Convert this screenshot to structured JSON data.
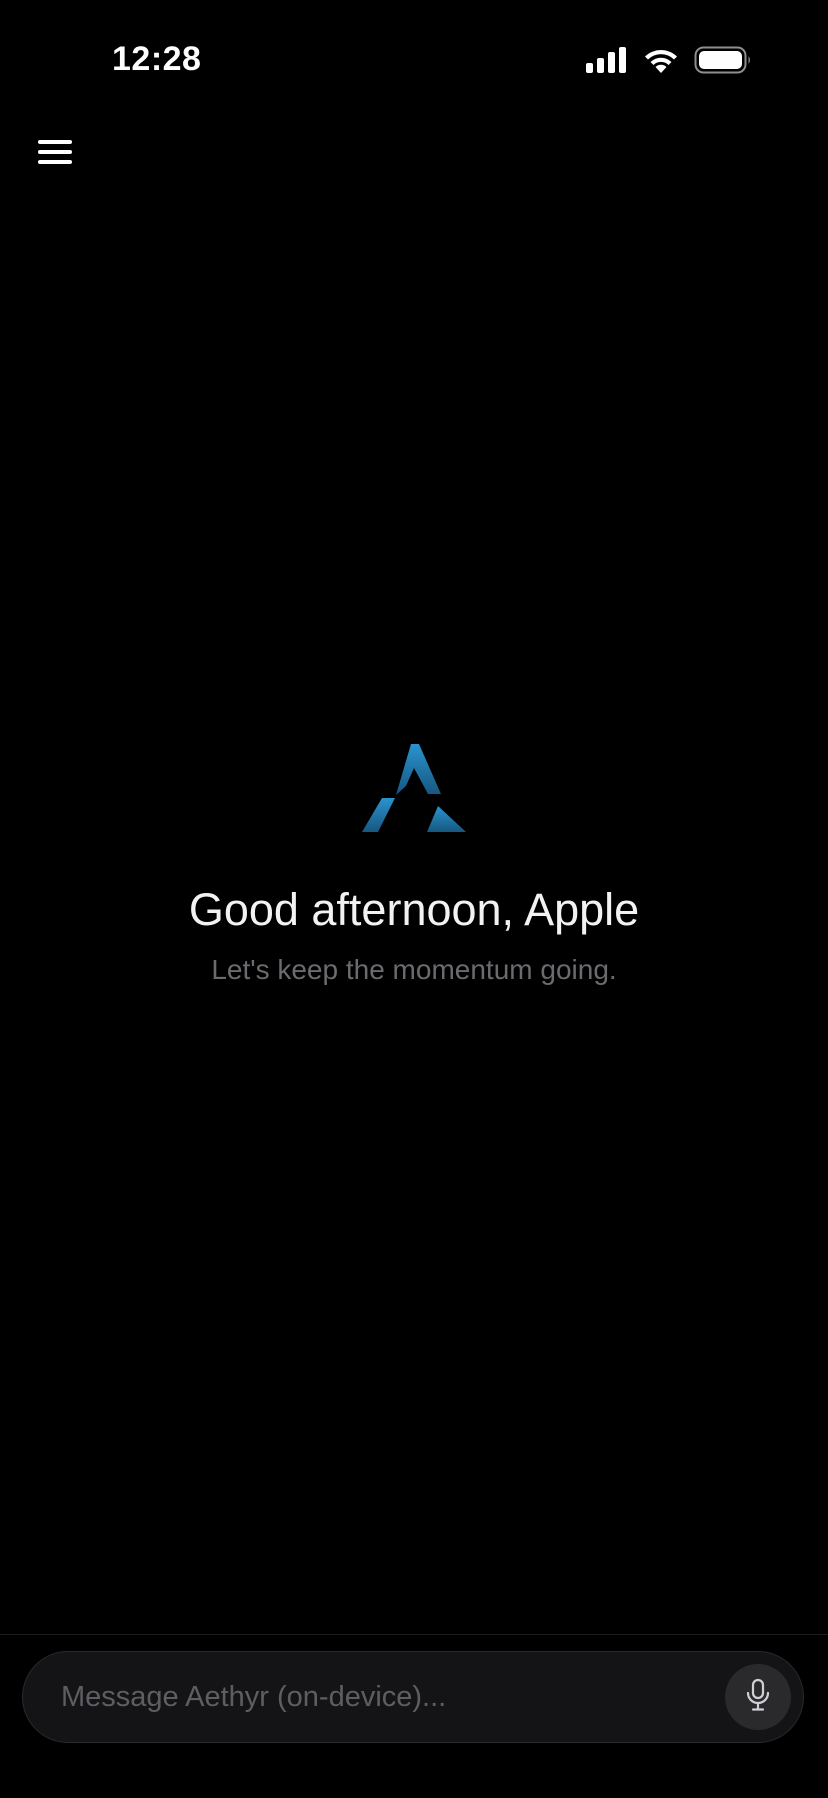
{
  "status_bar": {
    "time": "12:28"
  },
  "header": {
    "menu_icon": "hamburger-menu-icon"
  },
  "hero": {
    "logo": "aethyr-logo",
    "greeting": "Good afternoon, Apple",
    "subtitle": "Let's keep the momentum going."
  },
  "composer": {
    "placeholder": "Message Aethyr (on-device)...",
    "value": "",
    "mic_icon": "microphone-icon"
  },
  "colors": {
    "background": "#000000",
    "logo_accent": "#1f7db3",
    "subtitle_text": "#6b6b6f",
    "composer_bg": "#141416"
  }
}
